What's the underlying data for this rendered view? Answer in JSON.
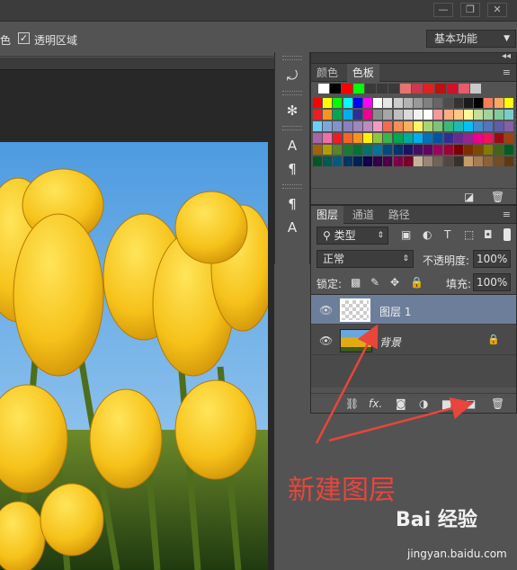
{
  "titlebar": {
    "buttons": [
      "—",
      "❐",
      "✕"
    ]
  },
  "options": {
    "partial_label": "色",
    "transparent_label": "透明区域",
    "workspace": "基本功能"
  },
  "toolstrip": {
    "tools": [
      "history-icon",
      "action-wheel-icon",
      "character-icon",
      "paragraph-icon",
      "paragraph-style-icon",
      "character-style-icon"
    ]
  },
  "swatches_panel": {
    "tabs": [
      "颜色",
      "色板"
    ],
    "active_tab": "色板",
    "recent": [
      "#ffffff",
      "#000000",
      "#ff0000",
      "#00ff00",
      "#3a3a3a",
      "#3a3a3a",
      "#3a3a3a",
      "#e8736e",
      "#c93a4c",
      "#dd2222",
      "#bb1111",
      "#d1102a",
      "#e85b6a",
      "#c9c9c9"
    ],
    "grid": [
      [
        "#ff0000",
        "#ffff00",
        "#00ff00",
        "#00ffff",
        "#0000ff",
        "#ff00ff",
        "#ffffff",
        "#e6e6e6",
        "#cccccc",
        "#b3b3b3",
        "#999999",
        "#808080",
        "#666666",
        "#4d4d4d",
        "#333333",
        "#1a1a1a",
        "#000000",
        "#f57e5b",
        "#f9a864",
        "#ffff00"
      ],
      [
        "#ee1c25",
        "#f7941d",
        "#00a651",
        "#00aeef",
        "#2e3192",
        "#ec008c",
        "#8c8c8c",
        "#a6a6a6",
        "#bfbfbf",
        "#d9d9d9",
        "#f2f2f2",
        "#ffffff",
        "#f5989d",
        "#f9ad81",
        "#fdc68a",
        "#fff799",
        "#c4df9b",
        "#a3d39c",
        "#82ca9c",
        "#7accc8"
      ],
      [
        "#6dcff6",
        "#7da7d9",
        "#8393ca",
        "#8781bd",
        "#a186be",
        "#bd8cbf",
        "#f49ac1",
        "#f26c4f",
        "#f68e56",
        "#fbaf5d",
        "#fff568",
        "#acd373",
        "#7cc576",
        "#3bb878",
        "#1abbb4",
        "#00bff3",
        "#448ccb",
        "#5574b9",
        "#605ca8",
        "#855fa8"
      ],
      [
        "#a864a8",
        "#f06ea9",
        "#ed1c24",
        "#f26522",
        "#f7941d",
        "#fff200",
        "#8dc63f",
        "#39b54a",
        "#00a651",
        "#00a99d",
        "#00aeef",
        "#0072bc",
        "#0054a6",
        "#2e3192",
        "#662d91",
        "#92278f",
        "#ec008c",
        "#ed145b",
        "#9e0b0f",
        "#a0410d"
      ],
      [
        "#a3620a",
        "#aba000",
        "#598527",
        "#197b30",
        "#007236",
        "#00746b",
        "#0076a3",
        "#004a80",
        "#003471",
        "#1b1464",
        "#440e62",
        "#630460",
        "#9e005d",
        "#9e0039",
        "#790000",
        "#7b2e00",
        "#7d4900",
        "#827b00",
        "#406618",
        "#005e20"
      ],
      [
        "#005826",
        "#005952",
        "#005b7f",
        "#003663",
        "#002157",
        "#0d004c",
        "#32004b",
        "#4b0049",
        "#7b0046",
        "#7a0026",
        "#c7b299",
        "#998675",
        "#736357",
        "#534741",
        "#37302d",
        "#c69c6d",
        "#a67c52",
        "#8c6239",
        "#754c24",
        "#603913"
      ]
    ]
  },
  "layers_panel": {
    "tabs": [
      "图层",
      "通道",
      "路径"
    ],
    "active_tab": "图层",
    "filter": "类型",
    "blend_mode": "正常",
    "opacity_label": "不透明度:",
    "opacity_value": "100%",
    "lock_label": "锁定:",
    "fill_label": "填充:",
    "fill_value": "100%",
    "layers": [
      {
        "name": "图层 1",
        "selected": true
      },
      {
        "name": "背景",
        "selected": false
      }
    ],
    "footer_icons": [
      "link-icon",
      "fx-icon",
      "mask-icon",
      "adjustment-icon",
      "group-folder-icon",
      "new-layer-icon",
      "trash-icon"
    ],
    "fx_label": "fx."
  },
  "annotation": {
    "text": "新建图层",
    "color": "#e8453c"
  },
  "watermark": {
    "logo": "Bai 经验",
    "url": "jingyan.baidu.com"
  }
}
